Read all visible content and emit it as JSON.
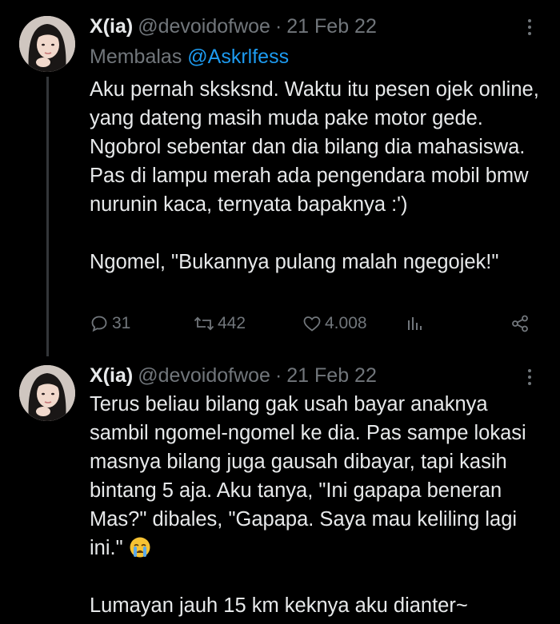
{
  "tweets": [
    {
      "name": "X(ia)",
      "handle": "@devoidofwoe",
      "separator": "·",
      "date": "21 Feb 22",
      "reply_prefix": "Membalas",
      "reply_mention": "@Askrlfess",
      "paragraphs": [
        "Aku pernah sksksnd. Waktu itu pesen ojek online, yang dateng masih muda pake motor gede. Ngobrol sebentar dan dia bilang dia mahasiswa. Pas di lampu merah ada pengendara mobil bmw nurunin kaca, ternyata bapaknya :')",
        "Ngomel, \"Bukannya pulang malah ngegojek!\""
      ],
      "stats": {
        "replies": "31",
        "retweets": "442",
        "likes": "4.008"
      },
      "icons": [
        "reply-icon",
        "retweet-icon",
        "like-icon",
        "views-icon",
        "share-icon"
      ]
    },
    {
      "name": "X(ia)",
      "handle": "@devoidofwoe",
      "separator": "·",
      "date": "21 Feb 22",
      "paragraphs": [
        "Terus beliau bilang gak usah bayar anaknya sambil ngomel-ngomel ke dia. Pas sampe lokasi masnya bilang juga gausah dibayar, tapi kasih bintang 5 aja. Aku tanya, \"Ini gapapa beneran Mas?\" dibales, \"Gapapa. Saya mau keliling lagi ini.\"",
        "Lumayan jauh 15 km keknya aku dianter~"
      ],
      "emoji": "crying-face-emoji"
    }
  ],
  "colors": {
    "background": "#000000",
    "text": "#e7e9ea",
    "muted": "#71767b",
    "mention": "#1d9bf0"
  }
}
